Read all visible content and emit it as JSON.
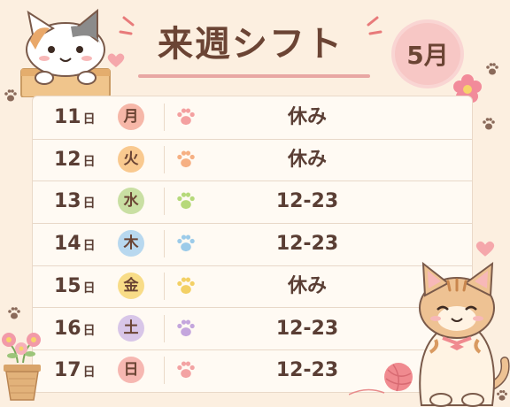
{
  "title": "来週シフト",
  "month": "5月",
  "day_suffix": "日",
  "rows": [
    {
      "date": "11",
      "dow": "月",
      "shift": "休み",
      "dow_color": "#f6b7a8",
      "paw_color": "#f4a0a0"
    },
    {
      "date": "12",
      "dow": "火",
      "shift": "休み",
      "dow_color": "#f9c98f",
      "paw_color": "#f6b083"
    },
    {
      "date": "13",
      "dow": "水",
      "shift": "12-23",
      "dow_color": "#c9dfa3",
      "paw_color": "#b6d97a"
    },
    {
      "date": "14",
      "dow": "木",
      "shift": "12-23",
      "dow_color": "#b8d8ef",
      "paw_color": "#9ccbe9"
    },
    {
      "date": "15",
      "dow": "金",
      "shift": "休み",
      "dow_color": "#f8dc87",
      "paw_color": "#f3d065"
    },
    {
      "date": "16",
      "dow": "土",
      "shift": "12-23",
      "dow_color": "#d8c6e8",
      "paw_color": "#c4a6dd"
    },
    {
      "date": "17",
      "dow": "日",
      "shift": "12-23",
      "dow_color": "#f6b7b1",
      "paw_color": "#f3a3a3"
    }
  ]
}
